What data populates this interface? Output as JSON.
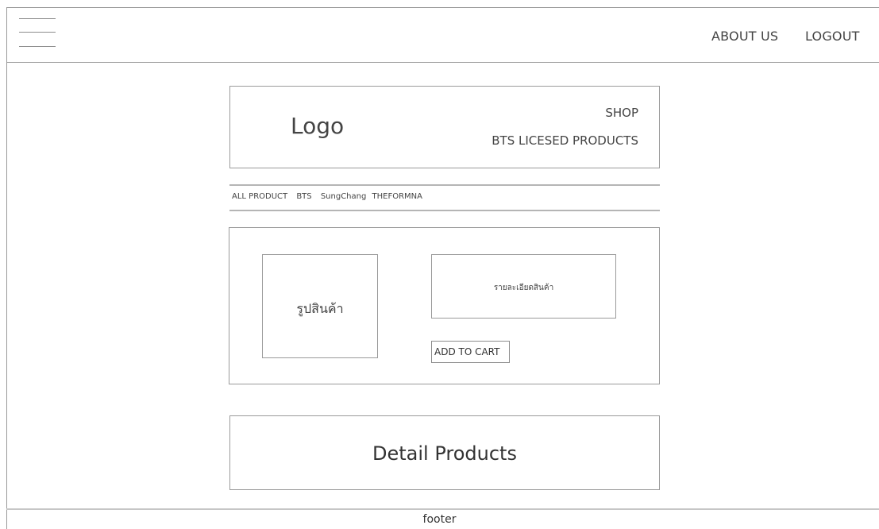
{
  "header": {
    "nav": {
      "about_us": "ABOUT US",
      "logout": "LOGOUT"
    }
  },
  "brand": {
    "logo": "Logo",
    "shop": "SHOP",
    "tagline": "BTS LICESED PRODUCTS"
  },
  "categories": [
    "ALL PRODUCT",
    "BTS",
    "SungChang",
    "THEFORMNA"
  ],
  "product": {
    "image_label": "รูปสินค้า",
    "description_label": "รายละเอียดสินค้า",
    "add_to_cart": "ADD TO CART"
  },
  "detail": {
    "title": "Detail Products"
  },
  "footer": {
    "text": "footer"
  },
  "icons": {
    "menu": "hamburger-menu-icon"
  }
}
